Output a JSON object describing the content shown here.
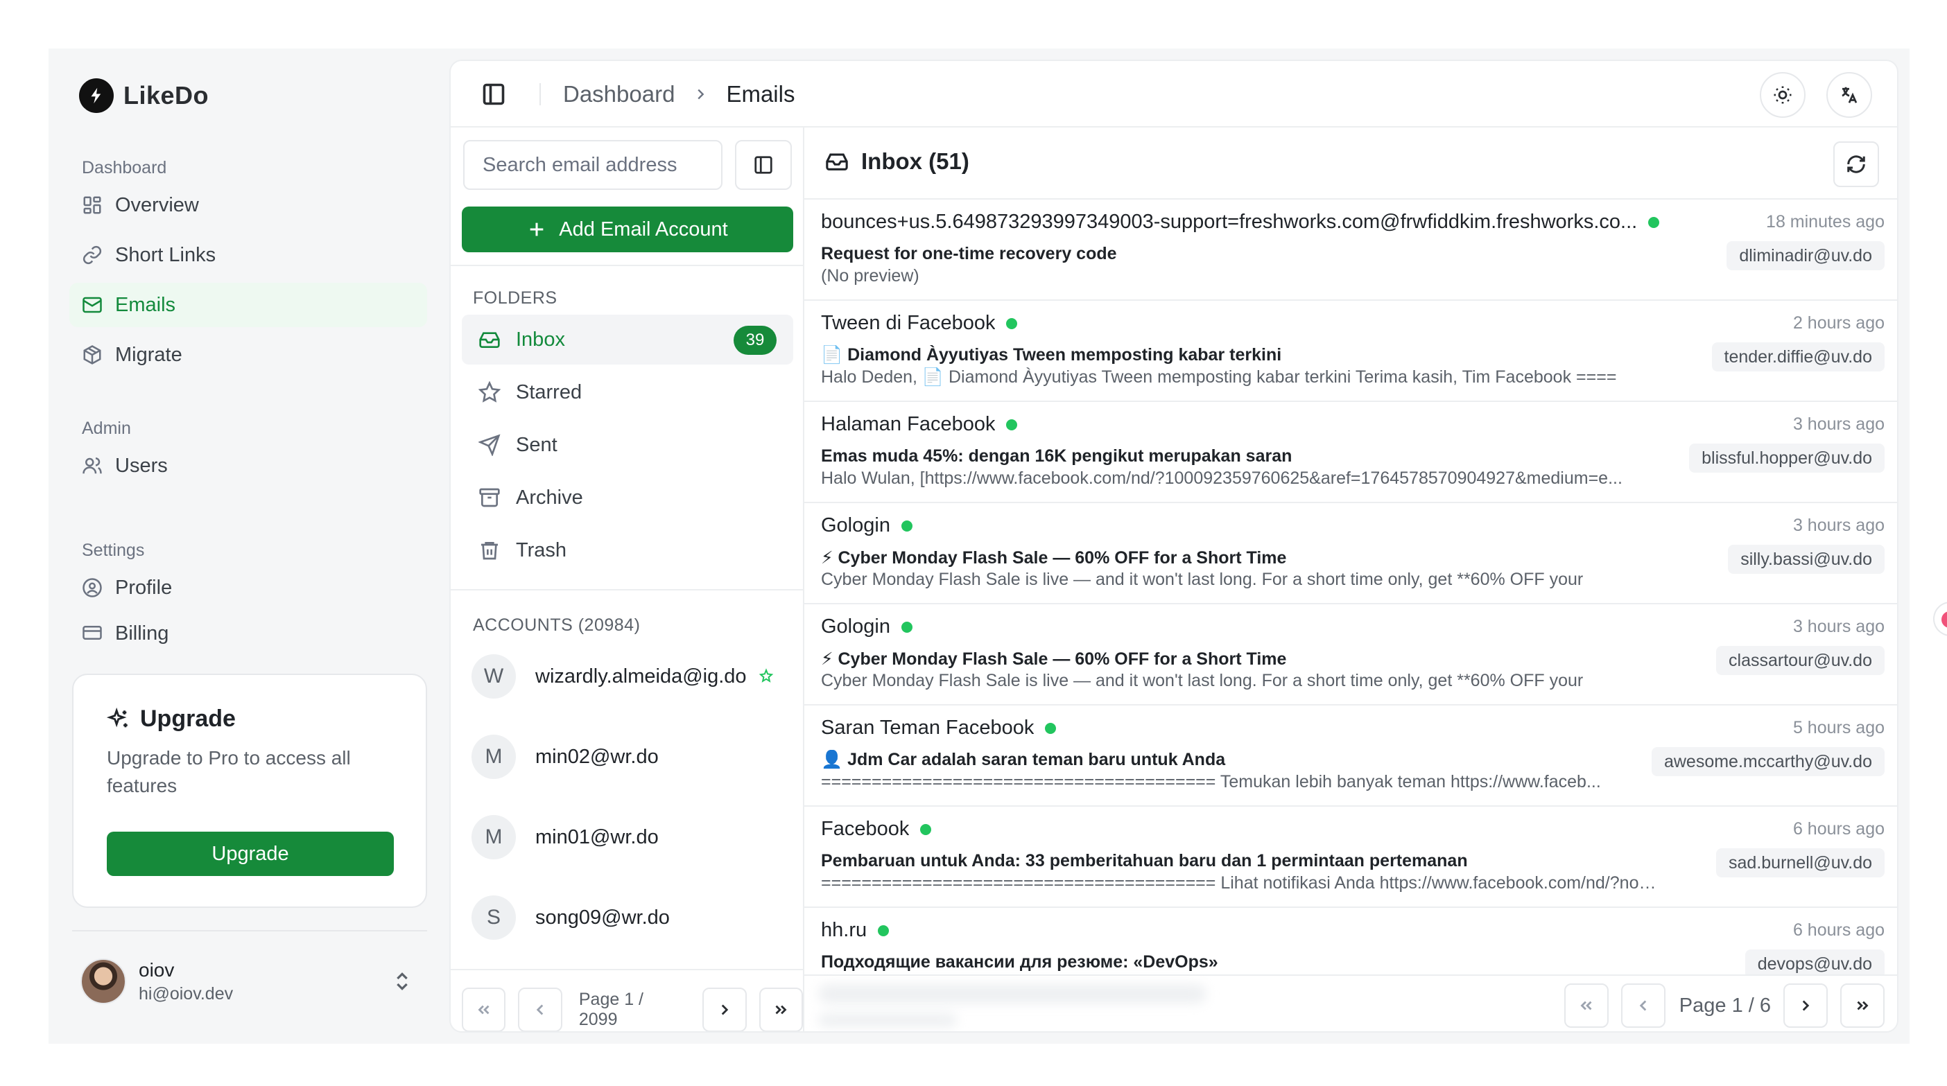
{
  "brand": {
    "name": "LikeDo"
  },
  "sidebar": {
    "groups": [
      {
        "label": "Dashboard",
        "items": [
          {
            "label": "Overview",
            "icon": "grid-icon"
          },
          {
            "label": "Short Links",
            "icon": "link-icon"
          },
          {
            "label": "Emails",
            "icon": "mail-icon",
            "active": true
          },
          {
            "label": "Migrate",
            "icon": "package-icon"
          }
        ]
      },
      {
        "label": "Admin",
        "items": [
          {
            "label": "Users",
            "icon": "users-icon"
          }
        ]
      },
      {
        "label": "Settings",
        "items": [
          {
            "label": "Profile",
            "icon": "user-circle-icon"
          },
          {
            "label": "Billing",
            "icon": "credit-card-icon"
          }
        ]
      }
    ],
    "upgrade": {
      "title": "Upgrade",
      "description": "Upgrade to Pro to access all features",
      "button": "Upgrade"
    },
    "user": {
      "name": "oiov",
      "email": "hi@oiov.dev"
    }
  },
  "header": {
    "breadcrumb": [
      "Dashboard",
      "Emails"
    ],
    "icons": [
      "panel-left-icon",
      "sun-icon",
      "translate-icon"
    ]
  },
  "folders_panel": {
    "search_placeholder": "Search email address",
    "add_button": "Add Email Account",
    "folders_label": "FOLDERS",
    "folders": [
      {
        "label": "Inbox",
        "count": "39",
        "active": true
      },
      {
        "label": "Starred"
      },
      {
        "label": "Sent"
      },
      {
        "label": "Archive"
      },
      {
        "label": "Trash"
      }
    ],
    "accounts_label": "ACCOUNTS (20984)",
    "accounts": [
      {
        "initial": "W",
        "email": "wizardly.almeida@ig.do",
        "starred": true
      },
      {
        "initial": "M",
        "email": "min02@wr.do"
      },
      {
        "initial": "M",
        "email": "min01@wr.do"
      },
      {
        "initial": "S",
        "email": "song09@wr.do"
      }
    ],
    "pager": "Page 1 / 2099"
  },
  "inbox": {
    "title": "Inbox (51)",
    "emails": [
      {
        "from": "bounces+us.5.649873293997349003-support=freshworks.com@frwfiddkim.freshworks.co...",
        "time": "18 minutes ago",
        "subject": "Request for one-time recovery code",
        "preview": "(No preview)",
        "to": "dliminadir@uv.do"
      },
      {
        "from": "Tween di Facebook",
        "time": "2 hours ago",
        "subject": "📄 Diamond Àyyutiyas Tween memposting kabar terkini",
        "preview": "Halo Deden, 📄 Diamond Àyyutiyas Tween memposting kabar terkini Terima kasih, Tim Facebook ====",
        "to": "tender.diffie@uv.do"
      },
      {
        "from": "Halaman Facebook",
        "time": "3 hours ago",
        "subject": "Emas muda 45%: dengan 16K pengikut merupakan saran",
        "preview": "Halo Wulan, [https://www.facebook.com/nd/?100092359760625&aref=1764578570904927&medium=e...",
        "to": "blissful.hopper@uv.do"
      },
      {
        "from": "Gologin",
        "time": "3 hours ago",
        "subject": "⚡ Cyber Monday Flash Sale — 60% OFF for a Short Time",
        "preview": "Cyber Monday Flash Sale is live — and it won't last long. For a short time only, get **60% OFF your",
        "to": "silly.bassi@uv.do"
      },
      {
        "from": "Gologin",
        "time": "3 hours ago",
        "subject": "⚡ Cyber Monday Flash Sale — 60% OFF for a Short Time",
        "preview": "Cyber Monday Flash Sale is live — and it won't last long. For a short time only, get **60% OFF your",
        "to": "classartour@uv.do"
      },
      {
        "from": "Saran Teman Facebook",
        "time": "5 hours ago",
        "subject": "👤 Jdm Car adalah saran teman baru untuk Anda",
        "preview": "======================================= Temukan lebih banyak teman https://www.faceb...",
        "to": "awesome.mccarthy@uv.do"
      },
      {
        "from": "Facebook",
        "time": "6 hours ago",
        "subject": "Pembaruan untuk Anda: 33 pemberitahuan baru dan 1 permintaan pertemanan",
        "preview": "======================================= Lihat notifikasi Anda https://www.facebook.com/nd/?noti...",
        "to": "sad.burnell@uv.do"
      },
      {
        "from": "hh.ru",
        "time": "6 hours ago",
        "subject": "Подходящие вакансии для резюме: «DevOps»",
        "preview": "",
        "to": "devops@uv.do"
      }
    ],
    "pager": "Page 1 / 6"
  }
}
